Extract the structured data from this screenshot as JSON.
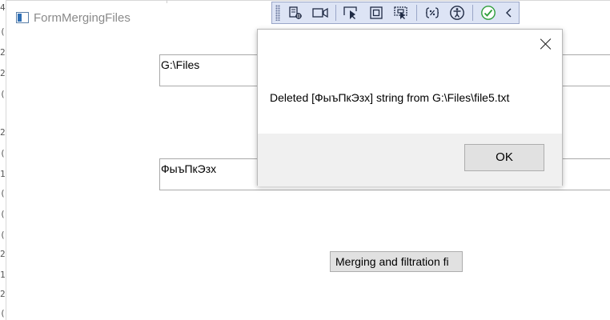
{
  "background": {
    "gutter_chars": [
      "4",
      "(",
      "2",
      "2",
      "(",
      "2",
      "(",
      "1",
      "(",
      "(",
      "(",
      "2",
      "1",
      "2",
      "("
    ]
  },
  "form": {
    "title": "FormMergingFiles",
    "path_field_value": "G:\\Files",
    "filter_field_value": "ФыъПкЭзх",
    "merge_button_label": "Merging and filtration fi"
  },
  "toolbar": {
    "buttons": [
      "select-element-icon",
      "video-camera-icon",
      "pointer-select-icon",
      "display-layout-adorners-icon",
      "track-focused-element-icon",
      "binding-failures-icon",
      "accessibility-icon",
      "checkmark-icon",
      "chevron-left-icon"
    ],
    "colors": {
      "background": "#dde4f5",
      "check": "#2e9e3a",
      "icon": "#1f2a44"
    }
  },
  "dialog": {
    "message": "Deleted [ФыъПкЭзх] string from G:\\Files\\file5.txt",
    "ok_label": "OK"
  }
}
